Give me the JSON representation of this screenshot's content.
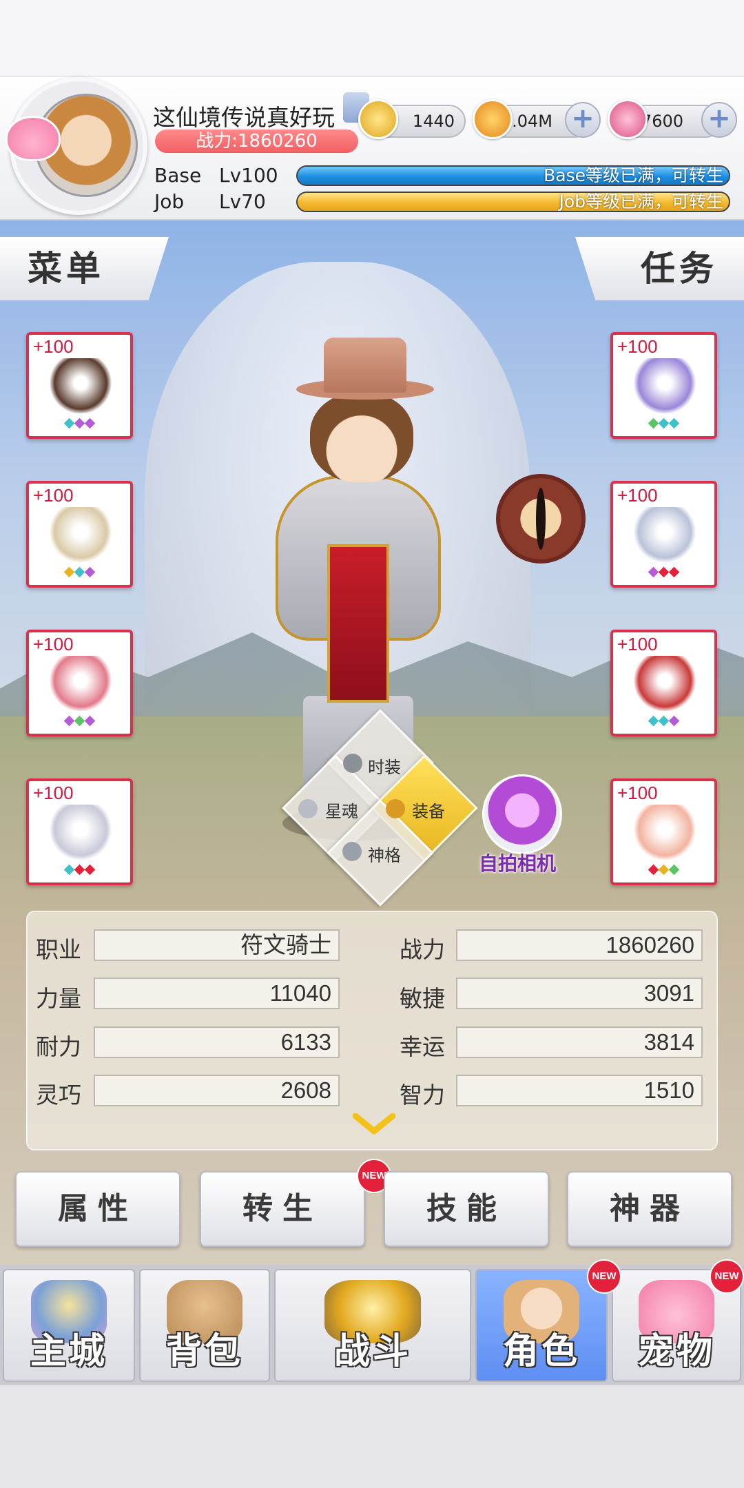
{
  "player": {
    "name": "这仙境传说真好玩",
    "power_text": "战力:1860260"
  },
  "currency": {
    "zeny": "1440",
    "gold": "30.04M",
    "gems": "7600"
  },
  "levels": {
    "base_label": "Base",
    "base_level": "Lv100",
    "base_bar_text": "Base等级已满，可转生",
    "base_fill": 1.0,
    "job_label": "Job",
    "job_level": "Lv70",
    "job_bar_text": "Job等级已满，可转生",
    "job_fill": 1.0
  },
  "side_tabs": {
    "menu": "菜单",
    "quest": "任务"
  },
  "equipment": {
    "left": [
      {
        "level": "+100",
        "icon": "witch-hat-icon",
        "color": "#5a3b2e",
        "gems": [
          "#3fc1c9",
          "#b45cd6",
          "#b45cd6"
        ]
      },
      {
        "level": "+100",
        "icon": "sword-icon",
        "color": "#d9c9a6",
        "gems": [
          "#e8b41d",
          "#3fc1c9",
          "#b45cd6"
        ]
      },
      {
        "level": "+100",
        "icon": "hood-cloak-icon",
        "color": "#e27a8a",
        "gems": [
          "#b45cd6",
          "#5ac466",
          "#b45cd6"
        ]
      },
      {
        "level": "+100",
        "icon": "ring-icon",
        "color": "#c8c8d8",
        "gems": [
          "#3fc1c9",
          "#e4213a",
          "#e4213a"
        ]
      }
    ],
    "right": [
      {
        "level": "+100",
        "icon": "robe-icon",
        "color": "#9a86d8",
        "gems": [
          "#5ac466",
          "#3fc1c9",
          "#3fc1c9"
        ]
      },
      {
        "level": "+100",
        "icon": "dagger-icon",
        "color": "#b9c2d8",
        "gems": [
          "#b45cd6",
          "#e4213a",
          "#e4213a"
        ]
      },
      {
        "level": "+100",
        "icon": "shoes-icon",
        "color": "#c93a3a",
        "gems": [
          "#3fc1c9",
          "#3fc1c9",
          "#b45cd6"
        ]
      },
      {
        "level": "+100",
        "icon": "scarf-icon",
        "color": "#f2b39f",
        "gems": [
          "#e4213a",
          "#e8b41d",
          "#5ac466"
        ]
      }
    ]
  },
  "diamond_menu": {
    "fashion": "时装",
    "star_soul": "星魂",
    "equip": "装备",
    "divinity": "神格"
  },
  "camera_label": "自拍相机",
  "stats": {
    "job_label": "职业",
    "job_value": "符文骑士",
    "power_label": "战力",
    "power_value": "1860260",
    "str_label": "力量",
    "str_value": "11040",
    "agi_label": "敏捷",
    "agi_value": "3091",
    "vit_label": "耐力",
    "vit_value": "6133",
    "luk_label": "幸运",
    "luk_value": "3814",
    "dex_label": "灵巧",
    "dex_value": "2608",
    "int_label": "智力",
    "int_value": "1510"
  },
  "actions": {
    "attributes": "属性",
    "rebirth": "转生",
    "skills": "技能",
    "artifact": "神器",
    "new_badge": "NEW"
  },
  "nav": {
    "city": "主城",
    "bag": "背包",
    "battle": "战斗",
    "character": "角色",
    "pet": "宠物"
  },
  "colors": {
    "accent_red": "#e4213a",
    "base_bar": "#1e8fe0",
    "job_bar": "#f4b92f",
    "nav_active": "#6b97f5"
  }
}
